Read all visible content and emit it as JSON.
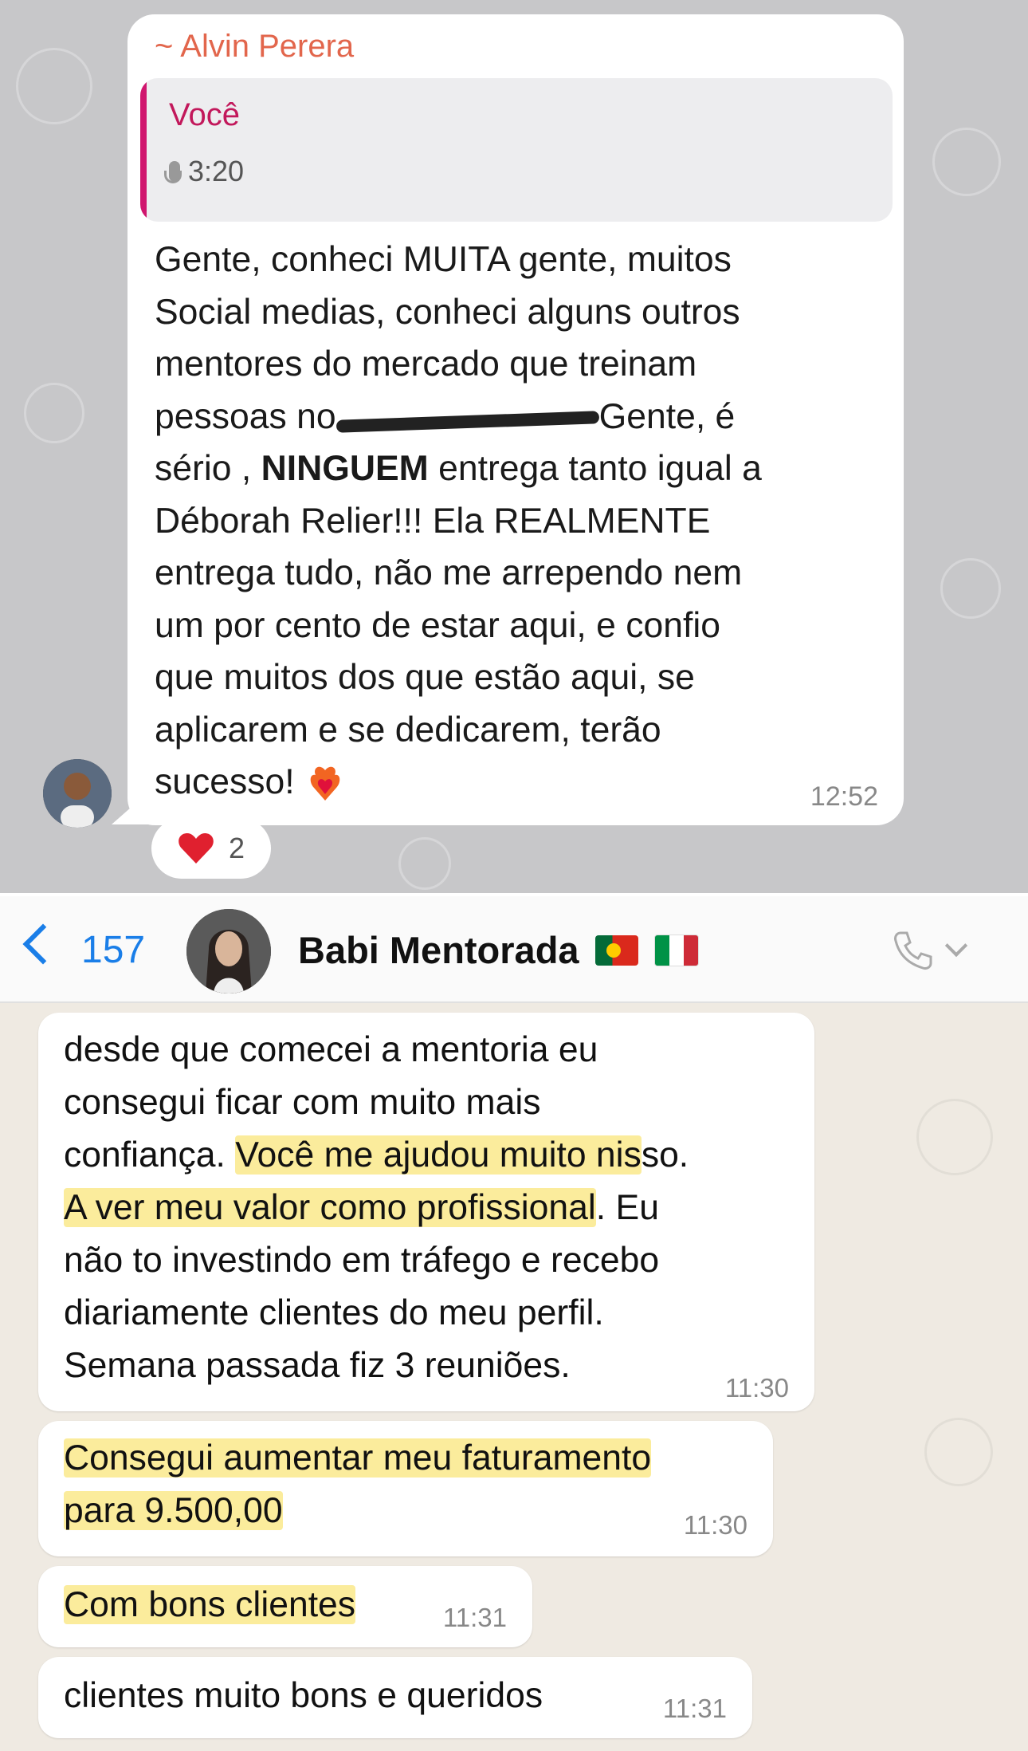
{
  "top": {
    "sender": "~ Alvin Perera",
    "quote": {
      "author": "Você",
      "audio_duration": "3:20",
      "icon": "microphone-icon"
    },
    "message": {
      "line1": "Gente, conheci MUITA gente, muitos",
      "line2": "Social medias, conheci alguns outros",
      "line3": "mentores do mercado que treinam",
      "line4_pre": "pessoas no",
      "line4_post": "Gente, é",
      "line5_pre": "sério ,",
      "line5_bold": "NINGUEM",
      "line5_post": "entrega tanto igual a",
      "line6": "Déborah Relier!!! Ela REALMENTE",
      "line7": "entrega tudo, não me arrependo nem",
      "line8": "um por cento de estar aqui, e confio",
      "line9": "que muitos dos que estão aqui, se",
      "line10": "aplicarem e se dedicarem, terão",
      "line11": "sucesso!"
    },
    "time": "12:52",
    "reaction": {
      "icon": "heart-icon",
      "count": "2"
    }
  },
  "header": {
    "back_count": "157",
    "contact_name": "Babi Mentorada",
    "flags": [
      "portugal-flag-icon",
      "italy-flag-icon"
    ]
  },
  "messages": [
    {
      "l1": "desde que comecei a mentoria eu",
      "l2": "consegui ficar com muito mais",
      "l3_pre": "confiança.",
      "l3_hl": "Você me ajudou muito nis",
      "l3_post": "so.",
      "l4_hl": "A ver meu valor como profissional",
      "l4_post": ". Eu",
      "l5": "não to investindo em tráfego e recebo",
      "l6": "diariamente clientes do meu perfil.",
      "l7": "Semana passada fiz 3 reuniões.",
      "time": "11:30"
    },
    {
      "l1": "Consegui aumentar meu faturamento",
      "l2": "para 9.500,00",
      "time": "11:30"
    },
    {
      "l1": "Com bons clientes",
      "time": "11:31"
    },
    {
      "l1": "clientes muito bons e queridos",
      "time": "11:31"
    }
  ],
  "colors": {
    "accent": "#1a7ee8",
    "highlight": "#fbec9c",
    "quote_bar": "#d0166e",
    "sender": "#e2664c"
  }
}
